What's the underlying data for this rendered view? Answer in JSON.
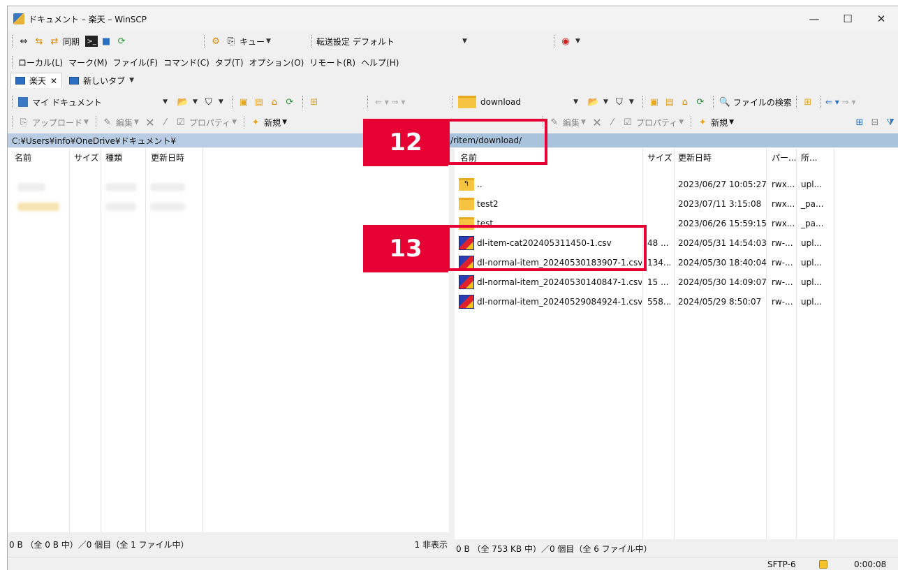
{
  "window": {
    "title": "ドキュメント – 楽天 – WinSCP",
    "min": "—",
    "max": "☐",
    "close": "✕"
  },
  "toolbar": {
    "sync_label": "同期",
    "queue_label": "キュー",
    "transfer_settings_label": "転送設定",
    "transfer_settings_value": "デフォルト"
  },
  "menu": [
    "ローカル(L)",
    "マーク(M)",
    "ファイル(F)",
    "コマンド(C)",
    "タブ(T)",
    "オプション(O)",
    "リモート(R)",
    "ヘルプ(H)"
  ],
  "tabs": {
    "active": "楽天",
    "new": "新しいタブ"
  },
  "local": {
    "location": "マイ ドキュメント",
    "upload": "アップロード",
    "edit": "編集",
    "properties": "プロパティ",
    "new": "新規",
    "path": "C:¥Users¥info¥OneDrive¥ドキュメント¥",
    "columns": [
      "名前",
      "サイズ",
      "種類",
      "更新日時"
    ],
    "status": "0 B （全 0 B 中）／0 個目（全 1 ファイル中）",
    "hidden": "1 非表示"
  },
  "remote": {
    "location": "download",
    "find_files": "ファイルの検索",
    "edit": "編集",
    "properties": "プロパティ",
    "new": "新規",
    "path": "/ritem/download/",
    "columns": [
      "名前",
      "サイズ",
      "更新日時",
      "パー...",
      "所..."
    ],
    "rows": [
      {
        "name": "..",
        "size": "",
        "date": "2023/06/27 10:05:27",
        "perm": "rwx...",
        "owner": "upl...",
        "type": "up"
      },
      {
        "name": "test2",
        "size": "",
        "date": "2023/07/11 3:15:08",
        "perm": "rwx...",
        "owner": "_pa...",
        "type": "folder"
      },
      {
        "name": "test",
        "size": "",
        "date": "2023/06/26 15:59:15",
        "perm": "rwx...",
        "owner": "_pa...",
        "type": "folder"
      },
      {
        "name": "dl-item-cat202405311450-1.csv",
        "size": "48 ...",
        "date": "2024/05/31 14:54:03",
        "perm": "rw-...",
        "owner": "upl...",
        "type": "csv"
      },
      {
        "name": "dl-normal-item_20240530183907-1.csv",
        "size": "134...",
        "date": "2024/05/30 18:40:04",
        "perm": "rw-...",
        "owner": "upl...",
        "type": "csv"
      },
      {
        "name": "dl-normal-item_20240530140847-1.csv",
        "size": "15 ...",
        "date": "2024/05/30 14:09:07",
        "perm": "rw-...",
        "owner": "upl...",
        "type": "csv"
      },
      {
        "name": "dl-normal-item_20240529084924-1.csv",
        "size": "558...",
        "date": "2024/05/29 8:50:07",
        "perm": "rw-...",
        "owner": "upl...",
        "type": "csv"
      }
    ],
    "status": "0 B （全 753 KB 中）／0 個目（全 6 ファイル中）"
  },
  "bottom": {
    "protocol": "SFTP-6",
    "time": "0:00:08"
  },
  "annotations": {
    "a12": "12",
    "a13": "13"
  },
  "colors": {
    "callout": "#e60033",
    "pathbar": "#b8cde3"
  }
}
